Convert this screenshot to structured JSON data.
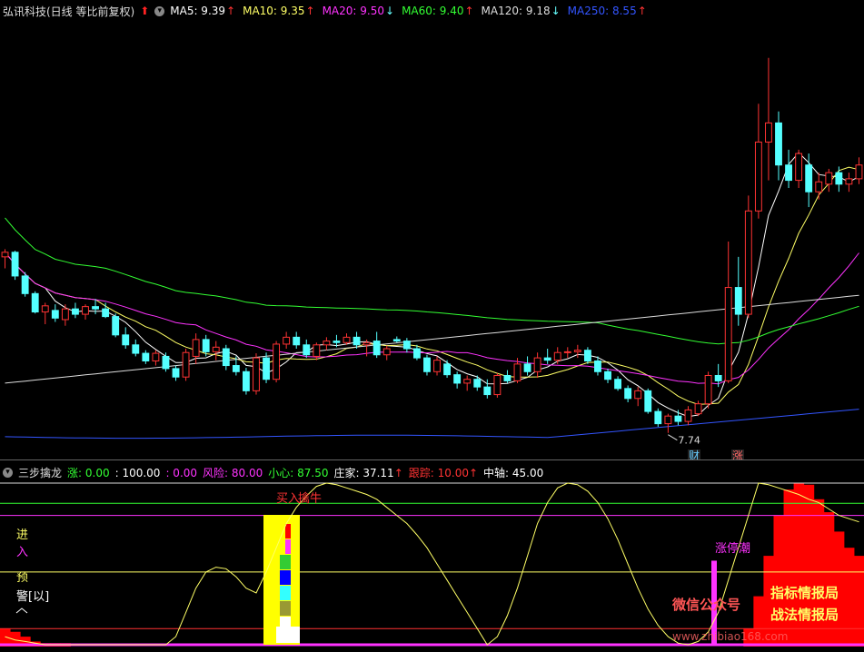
{
  "price_legend": {
    "title": "弘讯科技(日线 等比前复权)",
    "ma": [
      {
        "label": "MA5: 9.39",
        "arrow": "↑",
        "color": "#ffffff",
        "arrow_color": "#ff3333"
      },
      {
        "label": "MA10: 9.35",
        "arrow": "↑",
        "color": "#ffff66",
        "arrow_color": "#ff3333"
      },
      {
        "label": "MA20: 9.50",
        "arrow": "↓",
        "color": "#ff33ff",
        "arrow_color": "#66ffff"
      },
      {
        "label": "MA60: 9.40",
        "arrow": "↑",
        "color": "#33ff33",
        "arrow_color": "#ff3333"
      },
      {
        "label": "MA120: 9.18",
        "arrow": "↓",
        "color": "#dddddd",
        "arrow_color": "#66ffff"
      },
      {
        "label": "MA250: 8.55",
        "arrow": "↑",
        "color": "#3355ff",
        "arrow_color": "#ff3333"
      }
    ]
  },
  "indicator_legend": {
    "name": "三步擒龙",
    "items": [
      {
        "label": "涨: 0.00",
        "color": "#33ff33"
      },
      {
        "label": ": 100.00",
        "color": "#ffffff"
      },
      {
        "label": ": 0.00",
        "color": "#ff33ff"
      },
      {
        "label": "风险: 80.00",
        "color": "#ff33ff"
      },
      {
        "label": "小心: 87.50",
        "color": "#33ff33"
      },
      {
        "label": "庄家: 37.11",
        "color": "#ffffff",
        "arrow": "↑"
      },
      {
        "label": "跟踪: 10.00",
        "color": "#ff3333",
        "arrow": "↑"
      },
      {
        "label": "中轴: 45.00",
        "color": "#ffffff"
      }
    ]
  },
  "price_chart": {
    "low_label": "7.74",
    "badges": [
      {
        "text": "财",
        "color": "#66ccff"
      },
      {
        "text": "涨",
        "color": "#ff6666"
      }
    ]
  },
  "indicator_chart": {
    "left_labels": {
      "enter_a": "进",
      "enter_b": "入",
      "warn_a": "预",
      "warn_b": "警[以]"
    },
    "signal_buy": "买入",
    "signal_catch": "擒牛",
    "signal_limit": "涨停潮"
  },
  "watermark": {
    "left": "微信公众号",
    "right_top": "指标情报局",
    "right_bottom": "战法情报局",
    "url": "www.zhibiao168.com"
  },
  "colors": {
    "up": "#ff3333",
    "down": "#54ffff"
  },
  "chart_data": {
    "type": "candlestick",
    "candles": [
      [
        9.6,
        9.7,
        9.45,
        9.66
      ],
      [
        9.66,
        9.68,
        9.3,
        9.35
      ],
      [
        9.35,
        9.4,
        9.08,
        9.12
      ],
      [
        9.12,
        9.15,
        8.86,
        8.88
      ],
      [
        8.88,
        9.0,
        8.72,
        8.96
      ],
      [
        8.9,
        8.98,
        8.75,
        8.8
      ],
      [
        8.78,
        8.98,
        8.7,
        8.92
      ],
      [
        8.92,
        9.0,
        8.8,
        8.85
      ],
      [
        8.85,
        8.98,
        8.78,
        8.95
      ],
      [
        8.95,
        9.05,
        8.85,
        8.92
      ],
      [
        8.92,
        9.0,
        8.8,
        8.82
      ],
      [
        8.82,
        8.86,
        8.55,
        8.58
      ],
      [
        8.58,
        8.68,
        8.4,
        8.45
      ],
      [
        8.45,
        8.52,
        8.3,
        8.34
      ],
      [
        8.34,
        8.38,
        8.2,
        8.24
      ],
      [
        8.24,
        8.38,
        8.18,
        8.34
      ],
      [
        8.3,
        8.35,
        8.1,
        8.14
      ],
      [
        8.14,
        8.18,
        7.98,
        8.03
      ],
      [
        8.03,
        8.4,
        7.98,
        8.35
      ],
      [
        8.3,
        8.6,
        8.2,
        8.52
      ],
      [
        8.52,
        8.58,
        8.3,
        8.36
      ],
      [
        8.36,
        8.5,
        8.25,
        8.42
      ],
      [
        8.4,
        8.45,
        8.12,
        8.18
      ],
      [
        8.18,
        8.3,
        8.05,
        8.1
      ],
      [
        8.1,
        8.15,
        7.8,
        7.85
      ],
      [
        7.85,
        8.34,
        7.8,
        8.28
      ],
      [
        8.28,
        8.35,
        7.95,
        8.0
      ],
      [
        8.0,
        8.5,
        7.96,
        8.46
      ],
      [
        8.46,
        8.62,
        8.4,
        8.55
      ],
      [
        8.55,
        8.62,
        8.4,
        8.45
      ],
      [
        8.45,
        8.52,
        8.28,
        8.32
      ],
      [
        8.3,
        8.48,
        8.25,
        8.45
      ],
      [
        8.45,
        8.55,
        8.38,
        8.5
      ],
      [
        8.5,
        8.58,
        8.42,
        8.48
      ],
      [
        8.48,
        8.6,
        8.45,
        8.55
      ],
      [
        8.55,
        8.62,
        8.4,
        8.45
      ],
      [
        8.45,
        8.52,
        8.3,
        8.48
      ],
      [
        8.5,
        8.62,
        8.28,
        8.32
      ],
      [
        8.32,
        8.44,
        8.25,
        8.4
      ],
      [
        8.52,
        8.56,
        8.48,
        8.5
      ],
      [
        8.5,
        8.54,
        8.35,
        8.4
      ],
      [
        8.4,
        8.45,
        8.25,
        8.28
      ],
      [
        8.28,
        8.32,
        8.05,
        8.1
      ],
      [
        8.1,
        8.3,
        8.05,
        8.25
      ],
      [
        8.2,
        8.25,
        8.02,
        8.06
      ],
      [
        8.06,
        8.1,
        7.88,
        7.95
      ],
      [
        7.95,
        8.05,
        7.85,
        8.0
      ],
      [
        8.0,
        8.05,
        7.85,
        7.9
      ],
      [
        7.9,
        8.0,
        7.75,
        7.8
      ],
      [
        7.8,
        8.08,
        7.76,
        8.05
      ],
      [
        8.05,
        8.12,
        7.95,
        7.98
      ],
      [
        7.98,
        8.28,
        7.95,
        8.2
      ],
      [
        8.2,
        8.3,
        8.05,
        8.1
      ],
      [
        8.1,
        8.35,
        8.02,
        8.28
      ],
      [
        8.28,
        8.4,
        8.2,
        8.25
      ],
      [
        8.25,
        8.42,
        8.2,
        8.35
      ],
      [
        8.35,
        8.42,
        8.28,
        8.36
      ],
      [
        8.36,
        8.45,
        8.28,
        8.38
      ],
      [
        8.38,
        8.42,
        8.2,
        8.24
      ],
      [
        8.24,
        8.3,
        8.05,
        8.1
      ],
      [
        8.1,
        8.14,
        7.95,
        8.0
      ],
      [
        8.0,
        8.04,
        7.85,
        7.88
      ],
      [
        7.88,
        7.92,
        7.7,
        7.75
      ],
      [
        7.75,
        7.9,
        7.65,
        7.85
      ],
      [
        7.85,
        7.88,
        7.55,
        7.58
      ],
      [
        7.58,
        7.62,
        7.38,
        7.42
      ],
      [
        7.42,
        7.55,
        7.3,
        7.52
      ],
      [
        7.52,
        7.6,
        7.4,
        7.45
      ],
      [
        7.45,
        7.65,
        7.4,
        7.6
      ],
      [
        7.55,
        7.72,
        7.52,
        7.68
      ],
      [
        7.68,
        8.1,
        7.62,
        8.05
      ],
      [
        8.05,
        8.2,
        7.9,
        7.98
      ],
      [
        7.98,
        9.8,
        7.95,
        9.2
      ],
      [
        9.2,
        9.6,
        8.7,
        8.85
      ],
      [
        8.85,
        10.4,
        8.8,
        10.2
      ],
      [
        10.2,
        11.6,
        10.1,
        11.1
      ],
      [
        11.1,
        12.2,
        10.6,
        11.35
      ],
      [
        11.35,
        11.5,
        10.6,
        10.8
      ],
      [
        10.8,
        11.0,
        10.5,
        10.6
      ],
      [
        10.6,
        11.0,
        10.5,
        10.95
      ],
      [
        10.8,
        10.95,
        10.25,
        10.45
      ],
      [
        10.45,
        10.7,
        10.35,
        10.58
      ],
      [
        10.55,
        10.75,
        10.45,
        10.7
      ],
      [
        10.7,
        10.78,
        10.45,
        10.55
      ],
      [
        10.55,
        10.7,
        10.45,
        10.62
      ],
      [
        10.62,
        10.9,
        10.55,
        10.8
      ]
    ],
    "price_ylim": [
      7.0,
      12.6
    ],
    "low_value": 7.74,
    "series": [
      {
        "name": "MA5",
        "color": "#ffffff"
      },
      {
        "name": "MA10",
        "color": "#ffff66"
      },
      {
        "name": "MA20",
        "color": "#ff33ff"
      },
      {
        "name": "MA60",
        "color": "#33ff33"
      },
      {
        "name": "MA120",
        "color": "#dddddd"
      },
      {
        "name": "MA250",
        "color": "#3355ff"
      }
    ],
    "indicator": {
      "ylim": [
        0,
        100
      ],
      "hlines": [
        {
          "value": 100,
          "color": "#dddddd"
        },
        {
          "value": 87.5,
          "color": "#33ff33"
        },
        {
          "value": 80,
          "color": "#ff33ff"
        },
        {
          "value": 45,
          "color": "#ffff66"
        },
        {
          "value": 10,
          "color": "#ff3333"
        },
        {
          "value": 0,
          "color": "#ff33ff"
        }
      ],
      "zhuangjia": [
        5,
        3,
        2,
        1,
        0,
        0,
        0,
        0,
        0,
        0,
        0,
        0,
        0,
        0,
        0,
        0,
        0,
        5,
        20,
        35,
        45,
        48,
        47,
        42,
        35,
        32,
        45,
        60,
        75,
        85,
        92,
        98,
        100,
        99,
        97,
        95,
        93,
        90,
        85,
        80,
        75,
        68,
        60,
        50,
        40,
        30,
        20,
        10,
        0,
        5,
        18,
        35,
        55,
        75,
        88,
        97,
        100,
        99,
        95,
        88,
        78,
        65,
        50,
        35,
        22,
        12,
        5,
        1,
        0,
        2,
        8,
        20,
        40,
        60,
        80,
        100,
        99,
        97,
        95,
        93,
        90,
        88,
        84,
        80,
        78,
        76
      ],
      "tracking_bars": [
        10,
        8,
        5,
        2,
        1,
        1,
        1,
        0,
        0,
        0,
        0,
        0,
        0,
        0,
        0,
        0,
        0,
        0,
        0,
        0,
        0,
        0,
        0,
        0,
        0,
        0,
        0,
        0,
        0,
        0,
        0,
        0,
        0,
        0,
        0,
        0,
        0,
        0,
        0,
        0,
        0,
        0,
        0,
        0,
        0,
        0,
        0,
        0,
        0,
        0,
        0,
        0,
        0,
        0,
        0,
        0,
        0,
        0,
        0,
        0,
        0,
        0,
        0,
        0,
        0,
        0,
        0,
        0,
        0,
        0,
        0,
        0,
        0,
        0,
        10,
        30,
        55,
        80,
        96,
        100,
        99,
        90,
        82,
        70,
        60,
        55
      ]
    }
  }
}
